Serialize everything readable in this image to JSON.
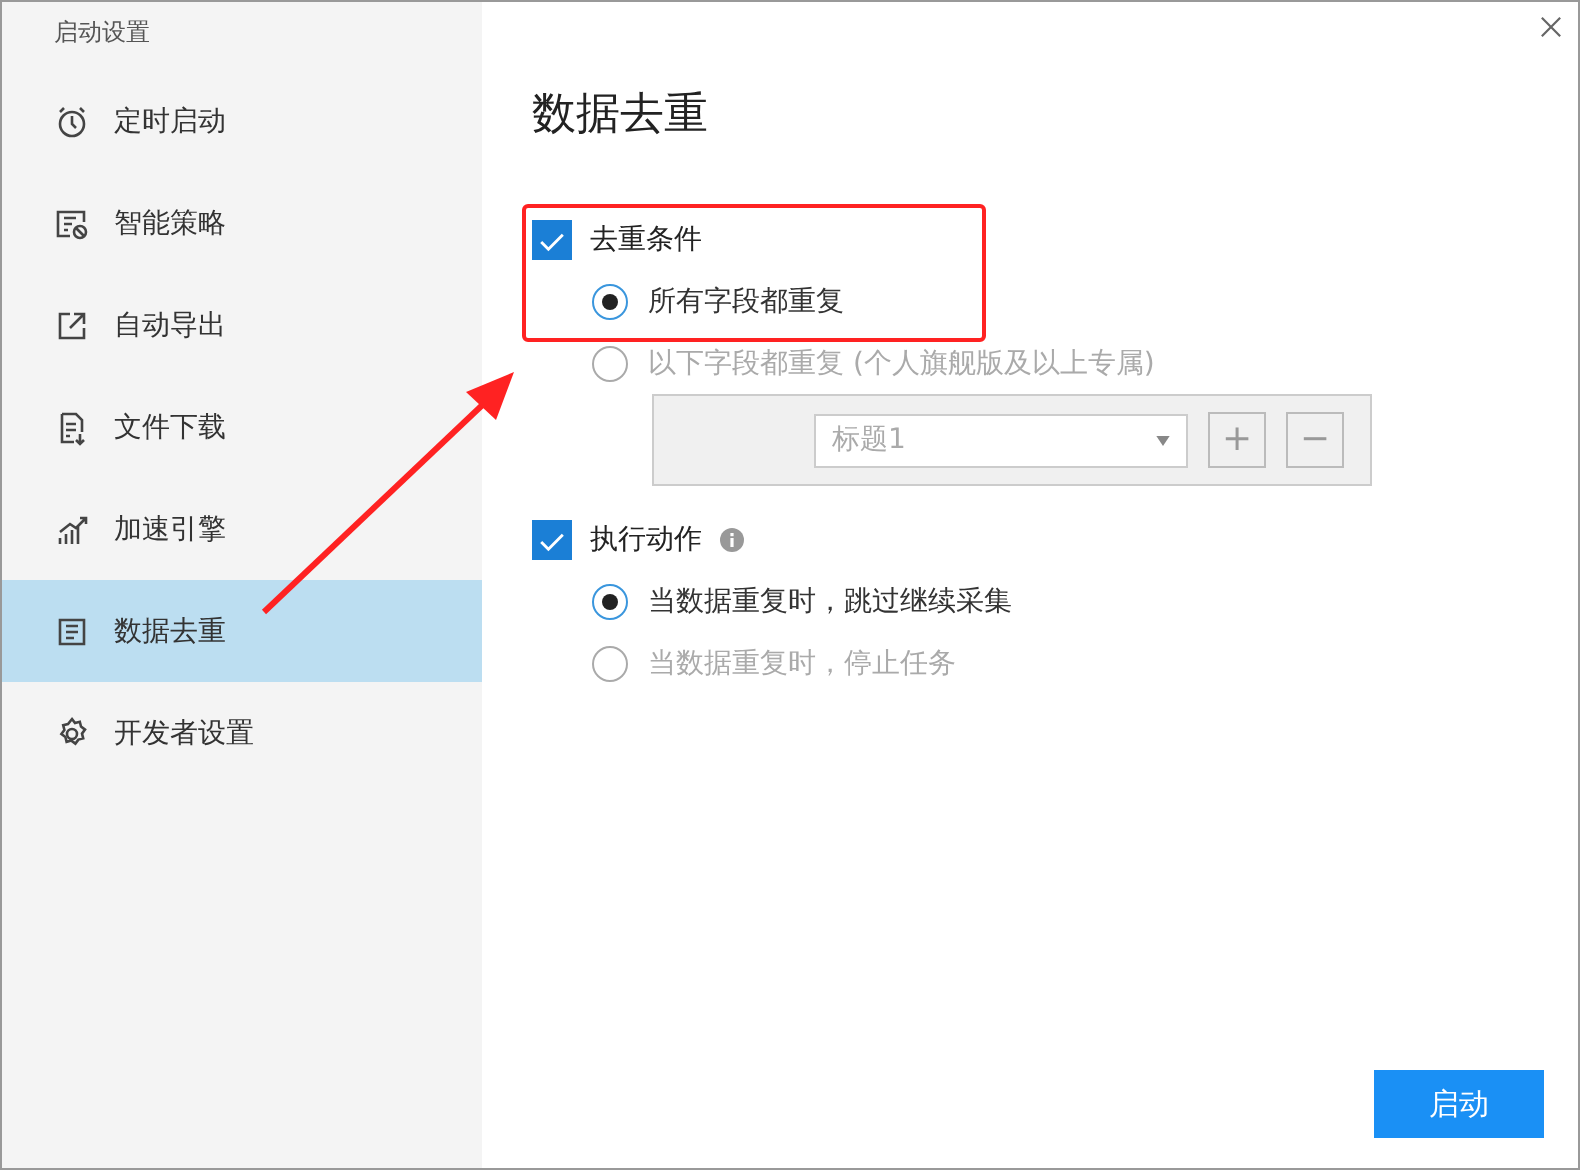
{
  "window": {
    "title": "启动设置"
  },
  "sidebar": {
    "items": [
      {
        "label": "定时启动",
        "selected": false
      },
      {
        "label": "智能策略",
        "selected": false
      },
      {
        "label": "自动导出",
        "selected": false
      },
      {
        "label": "文件下载",
        "selected": false
      },
      {
        "label": "加速引擎",
        "selected": false
      },
      {
        "label": "数据去重",
        "selected": true
      },
      {
        "label": "开发者设置",
        "selected": false
      }
    ]
  },
  "heading": "数据去重",
  "groups": [
    {
      "label": "去重条件",
      "checked": true,
      "info": false,
      "options": [
        {
          "label": "所有字段都重复",
          "selected": true,
          "disabled": false
        },
        {
          "label": "以下字段都重复 (个人旗舰版及以上专属)",
          "selected": false,
          "disabled": true,
          "field": {
            "value": "标题1",
            "add": "+",
            "remove": "−"
          }
        }
      ]
    },
    {
      "label": "执行动作",
      "checked": true,
      "info": true,
      "options": [
        {
          "label": "当数据重复时，跳过继续采集",
          "selected": true,
          "disabled": false
        },
        {
          "label": "当数据重复时，停止任务",
          "selected": false,
          "disabled": true
        }
      ]
    }
  ],
  "start_button": "启动"
}
